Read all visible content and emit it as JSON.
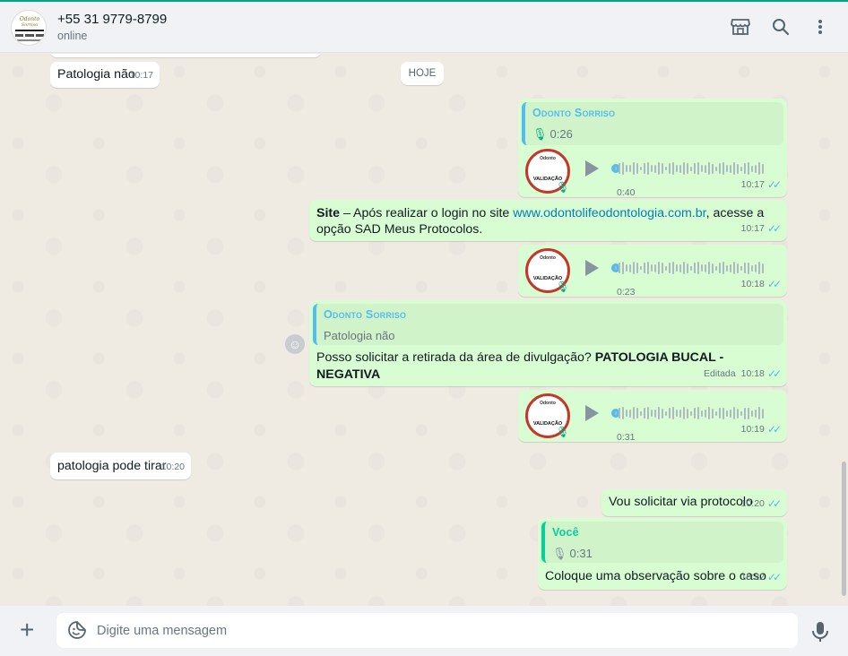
{
  "header": {
    "contact_name": "+55 31 9779-8799",
    "status": "online",
    "icons": [
      "store-icon",
      "search-icon",
      "menu-icon"
    ]
  },
  "date_chip": "HOJE",
  "messages": {
    "m1": {
      "text": "Patologia não",
      "time": "10:17"
    },
    "m2": {
      "quote_name": "Odonto Sorriso",
      "quote_text": "0:26",
      "duration": "0:40",
      "time": "10:17",
      "thumb": "VALIDAÇÃO"
    },
    "m3": {
      "bold": "Site",
      "text_a": " – Após realizar o login no site ",
      "link": "www.odontolifeodontologia.com.br",
      "text_b": ", acesse a opção SAD Meus Protocolos.",
      "time": "10:17"
    },
    "m4": {
      "duration": "0:23",
      "time": "10:18",
      "thumb": "VALIDAÇÃO"
    },
    "m5": {
      "quote_name": "Odonto Sorriso",
      "quote_text": "Patologia não",
      "text": "Posso solicitar a retirada da área de divulgação? ",
      "bold": "PATOLOGIA BUCAL  - NEGATIVA",
      "edited": "Editada",
      "time": "10:18"
    },
    "m6": {
      "duration": "0:31",
      "time": "10:19",
      "thumb": "VALIDAÇÃO"
    },
    "m7": {
      "text": "patologia pode tirar",
      "time": "10:20"
    },
    "m8": {
      "text": "Vou solicitar via protocolo",
      "time": "10:20"
    },
    "m9": {
      "quote_name": "Você",
      "quote_text": "0:31",
      "text": "Coloque uma observação sobre o caso",
      "time": "10:22"
    }
  },
  "composer": {
    "placeholder": "Digite uma mensagem"
  },
  "colors": {
    "outgoing": "#d9fdd3",
    "incoming": "#ffffff",
    "accent": "#00a884",
    "read_ticks": "#53bdeb"
  }
}
